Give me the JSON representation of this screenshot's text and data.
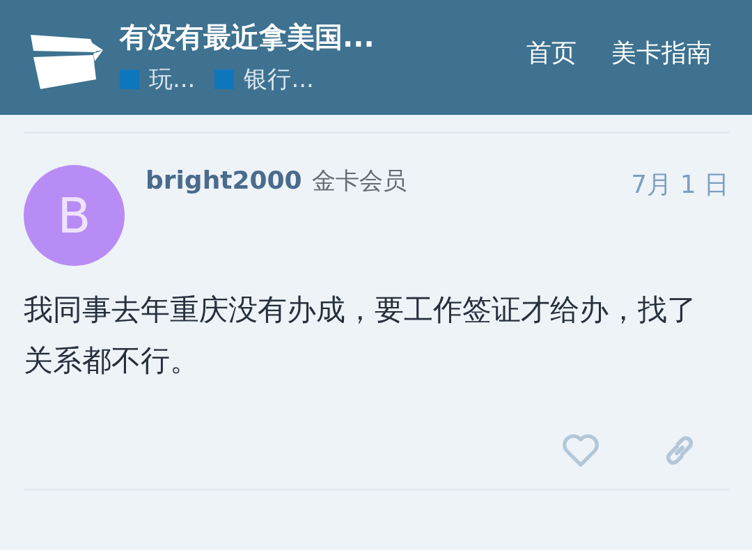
{
  "header": {
    "title": "有没有最近拿美国...",
    "categories": [
      {
        "name": "玩...",
        "color": "#0e76bd"
      },
      {
        "name": "银行...",
        "color": "#0e76bd"
      }
    ],
    "nav": [
      "首页",
      "美卡指南"
    ]
  },
  "post": {
    "avatar_letter": "B",
    "username": "bright2000",
    "user_title": "金卡会员",
    "date": "7月 1 日",
    "body": "我同事去年重庆没有办成，要工作签证才给办，找了关系都不行。",
    "liked": false
  }
}
